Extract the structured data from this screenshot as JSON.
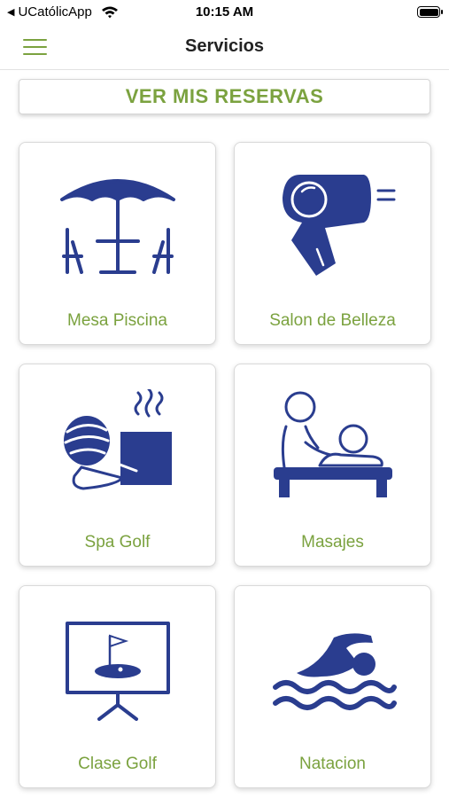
{
  "status_bar": {
    "back_app": "UCatólicApp",
    "time": "10:15 AM"
  },
  "header": {
    "title": "Servicios",
    "menu_icon": "hamburger-menu-icon"
  },
  "reservations_button": {
    "label": "VER MIS RESERVAS"
  },
  "colors": {
    "accent_green": "#7ba23f",
    "icon_navy": "#2a3d8f"
  },
  "services": [
    {
      "label": "Mesa Piscina",
      "icon": "umbrella-table-icon"
    },
    {
      "label": "Salon de Belleza",
      "icon": "hair-dryer-icon"
    },
    {
      "label": "Spa Golf",
      "icon": "spa-hot-stone-icon"
    },
    {
      "label": "Masajes",
      "icon": "massage-icon"
    },
    {
      "label": "Clase Golf",
      "icon": "golf-lesson-board-icon"
    },
    {
      "label": "Natacion",
      "icon": "swimmer-icon"
    }
  ]
}
